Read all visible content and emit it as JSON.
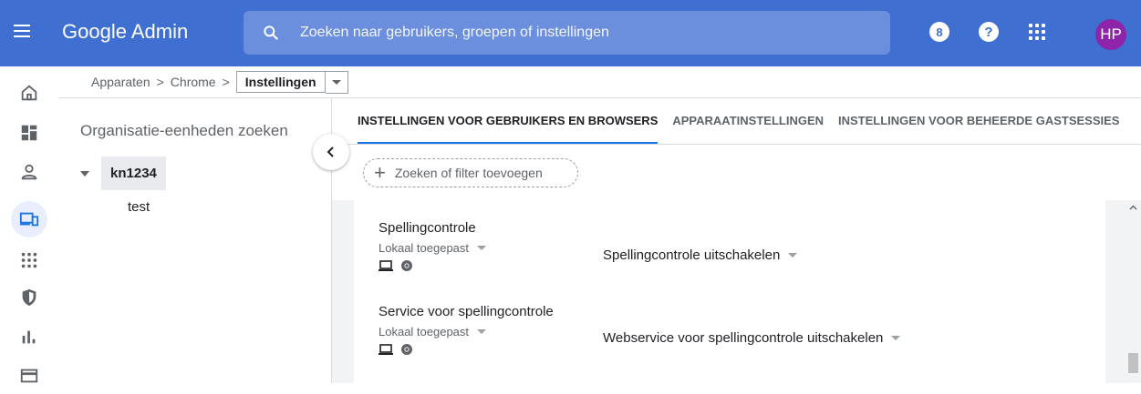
{
  "header": {
    "brand": "Google Admin",
    "search_placeholder": "Zoeken naar gebruikers, groepen of instellingen",
    "hourglass_badge": "8",
    "help_glyph": "?",
    "avatar_initials": "HP"
  },
  "rail": {
    "items": [
      {
        "icon": "home-icon"
      },
      {
        "icon": "dashboard-icon"
      },
      {
        "icon": "users-icon"
      },
      {
        "icon": "devices-icon",
        "active": true
      },
      {
        "icon": "apps-icon"
      },
      {
        "icon": "security-icon"
      },
      {
        "icon": "reports-icon"
      },
      {
        "icon": "billing-icon"
      }
    ]
  },
  "breadcrumb": {
    "items": [
      "Apparaten",
      "Chrome"
    ],
    "separator": ">",
    "current": "Instellingen"
  },
  "org_panel": {
    "search_placeholder": "Organisatie-eenheden zoeken",
    "root": "kn1234",
    "children": [
      "test"
    ]
  },
  "tabs": [
    {
      "label": "INSTELLINGEN VOOR GEBRUIKERS EN BROWSERS",
      "active": true
    },
    {
      "label": "APPARAATINSTELLINGEN",
      "active": false
    },
    {
      "label": "INSTELLINGEN VOOR BEHEERDE GASTSESSIES",
      "active": false
    }
  ],
  "filter": {
    "label": "Zoeken of filter toevoegen"
  },
  "settings": [
    {
      "title": "Spellingcontrole",
      "scope": "Lokaal toegepast",
      "value": "Spellingcontrole uitschakelen"
    },
    {
      "title": "Service voor spellingcontrole",
      "scope": "Lokaal toegepast",
      "value": "Webservice voor spellingcontrole uitschakelen"
    }
  ],
  "colors": {
    "topbar": "#3f6fd0",
    "accent": "#1a73e8",
    "avatar": "#8e24aa"
  }
}
